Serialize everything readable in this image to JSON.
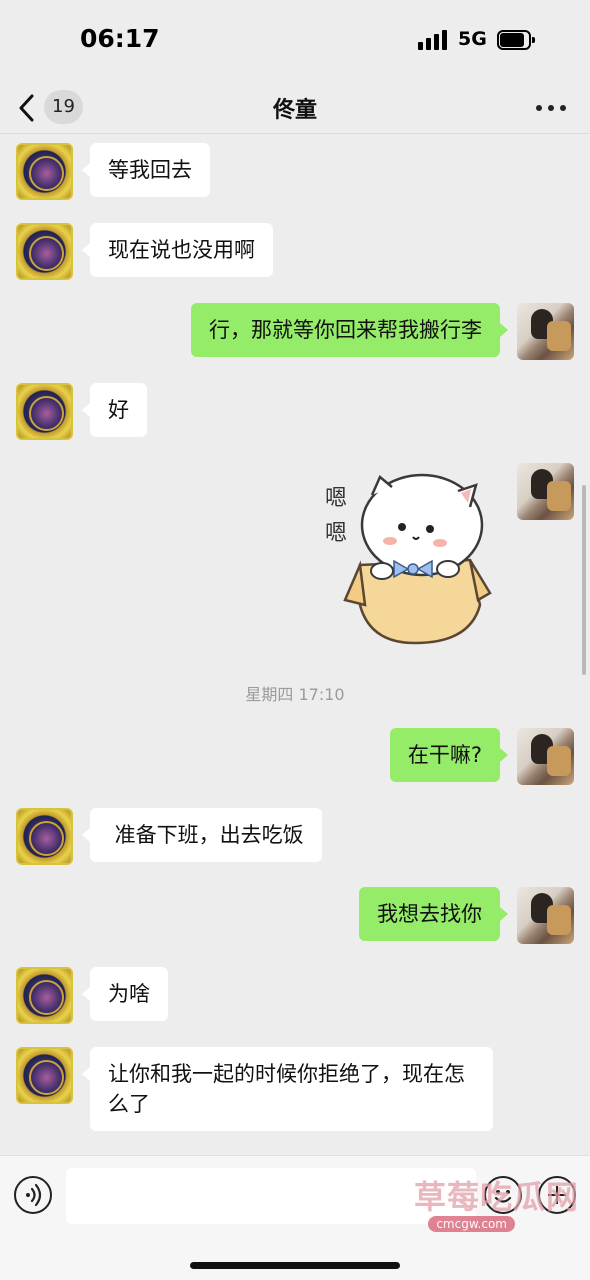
{
  "status_bar": {
    "time": "06:17",
    "network": "5G"
  },
  "nav": {
    "unread_count": "19",
    "title": "佟童"
  },
  "messages": [
    {
      "from": "contact",
      "text": "等我回去"
    },
    {
      "from": "contact",
      "text": "现在说也没用啊"
    },
    {
      "from": "self",
      "text": "行，那就等你回来帮我搬行李"
    },
    {
      "from": "contact",
      "text": "好"
    },
    {
      "from": "self",
      "type": "sticker",
      "sticker_text": "嗯嗯"
    },
    {
      "from": "self",
      "text": "在干嘛?"
    },
    {
      "from": "contact",
      "text": " 准备下班，出去吃饭"
    },
    {
      "from": "self",
      "text": "我想去找你"
    },
    {
      "from": "contact",
      "text": "为啥"
    },
    {
      "from": "contact",
      "text": "让你和我一起的时候你拒绝了，现在怎么了"
    }
  ],
  "timestamp": "星期四 17:10",
  "watermark": {
    "text": "草莓吃瓜网",
    "url": "cmcgw.com"
  },
  "colors": {
    "background": "#ededed",
    "out_bubble": "#95ec69",
    "in_bubble": "#ffffff"
  }
}
